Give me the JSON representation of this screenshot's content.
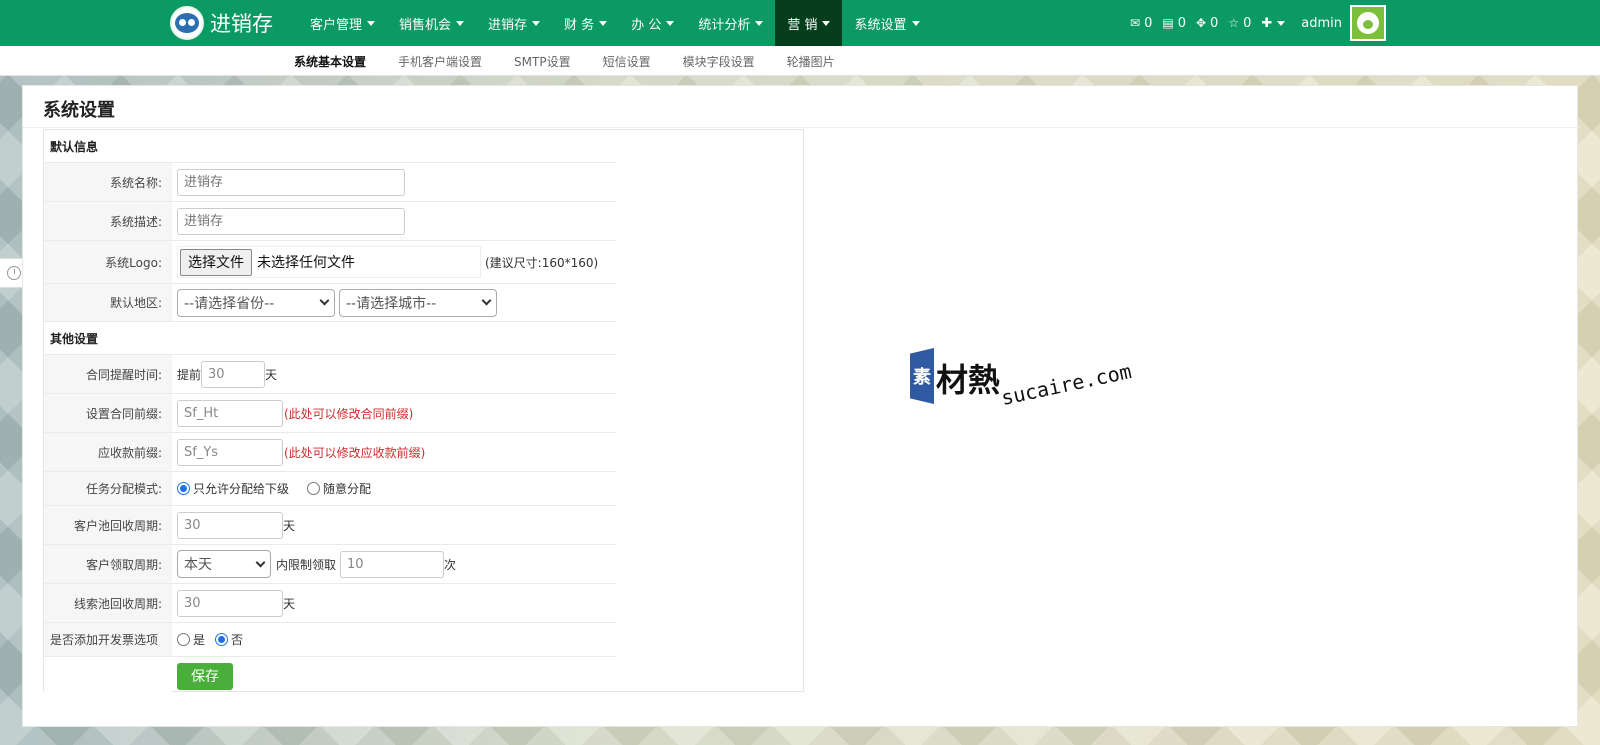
{
  "brand": {
    "name": "进销存"
  },
  "nav": {
    "items": [
      {
        "label": "客户管理"
      },
      {
        "label": "销售机会"
      },
      {
        "label": "进销存"
      },
      {
        "label": "财 务"
      },
      {
        "label": "办 公"
      },
      {
        "label": "统计分析"
      },
      {
        "label": "营 销"
      },
      {
        "label": "系统设置"
      }
    ],
    "active_index": 6
  },
  "nav_right": {
    "mail_count": "0",
    "msg_count": "0",
    "task_count": "0",
    "star_count": "0",
    "plus": "✚",
    "user": "admin"
  },
  "subnav": {
    "items": [
      "系统基本设置",
      "手机客户端设置",
      "SMTP设置",
      "短信设置",
      "模块字段设置",
      "轮播图片"
    ],
    "active_index": 0
  },
  "page": {
    "title": "系统设置"
  },
  "form": {
    "section_default": "默认信息",
    "system_name": {
      "label": "系统名称:",
      "placeholder": "进销存"
    },
    "system_desc": {
      "label": "系统描述:",
      "placeholder": "进销存"
    },
    "system_logo": {
      "label": "系统Logo:",
      "button": "选择文件",
      "file_text": "未选择任何文件",
      "hint": "(建议尺寸:160*160)"
    },
    "region": {
      "label": "默认地区:",
      "province": "--请选择省份--",
      "city": "--请选择城市--"
    },
    "section_other": "其他设置",
    "contract_remind": {
      "label": "合同提醒时间:",
      "prefix": "提前",
      "value": "30",
      "suffix": "天"
    },
    "contract_prefix": {
      "label": "设置合同前缀:",
      "value": "Sf_Ht",
      "note": "(此处可以修改合同前缀)"
    },
    "receivable_prefix": {
      "label": "应收款前缀:",
      "value": "Sf_Ys",
      "note": "(此处可以修改应收款前缀)"
    },
    "task_mode": {
      "label": "任务分配模式:",
      "option1": "只允许分配给下级",
      "option2": "随意分配",
      "selected": 1
    },
    "pool_recycle": {
      "label": "客户池回收周期:",
      "value": "30",
      "suffix": "天"
    },
    "claim_period": {
      "label": "客户领取周期:",
      "select": "本天",
      "middle": "内限制领取",
      "value": "10",
      "suffix": "次"
    },
    "lead_recycle": {
      "label": "线索池回收周期:",
      "value": "30",
      "suffix": "天"
    },
    "invoice_option": {
      "label": "是否添加开发票选项",
      "yes": "是",
      "no": "否",
      "selected": "no"
    },
    "save": "保存"
  },
  "watermark": {
    "mark": "素",
    "cn": "材熱",
    "en": "sucaire.com"
  },
  "colors": {
    "topbar": "#0b9a63",
    "active_nav": "#063d1d",
    "save_button": "#4aae3a",
    "note_red": "#d12b2b"
  }
}
